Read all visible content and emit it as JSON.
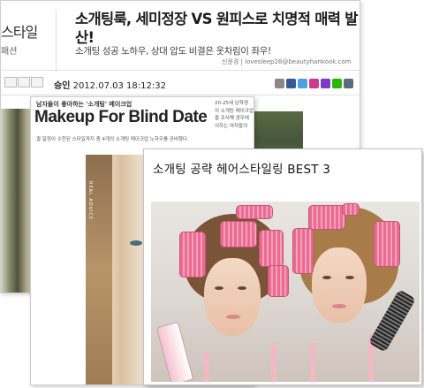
{
  "back_article": {
    "section_title": "스타일",
    "section_sub": "패션",
    "headline": "소개팅룩, 세미정장 VS 원피스로 치명적 매력 발산!",
    "subheadline": "소개팅 성공 노하우, 상대 압도 비결은 옷차림이 좌우!",
    "byline": "신윤경 | lovesleep28@beautyhankook.com",
    "published_label": "승인",
    "published_datetime": "2012.07.03  18:12:32"
  },
  "middle_page": {
    "kicker": "남자들이 좋아하는 '소개팅' 메이크업",
    "title": "Makeup For Blind Date",
    "description": "결 일정이 수천된 스타일까지 충 4개의 소개팅 메이크업 노하우를 공비했다.",
    "side_text": "20-25세 남학생 의 소개팅 메이크업 을 조사해 경우에 이하는 여자들의",
    "vertical_text": "REAL ADVICE"
  },
  "front_page": {
    "title": "소개팅 공략 헤어스타일링 BEST 3"
  },
  "colors": {
    "headline": "#1b1b1b",
    "curler_pink": "#e96b92"
  }
}
